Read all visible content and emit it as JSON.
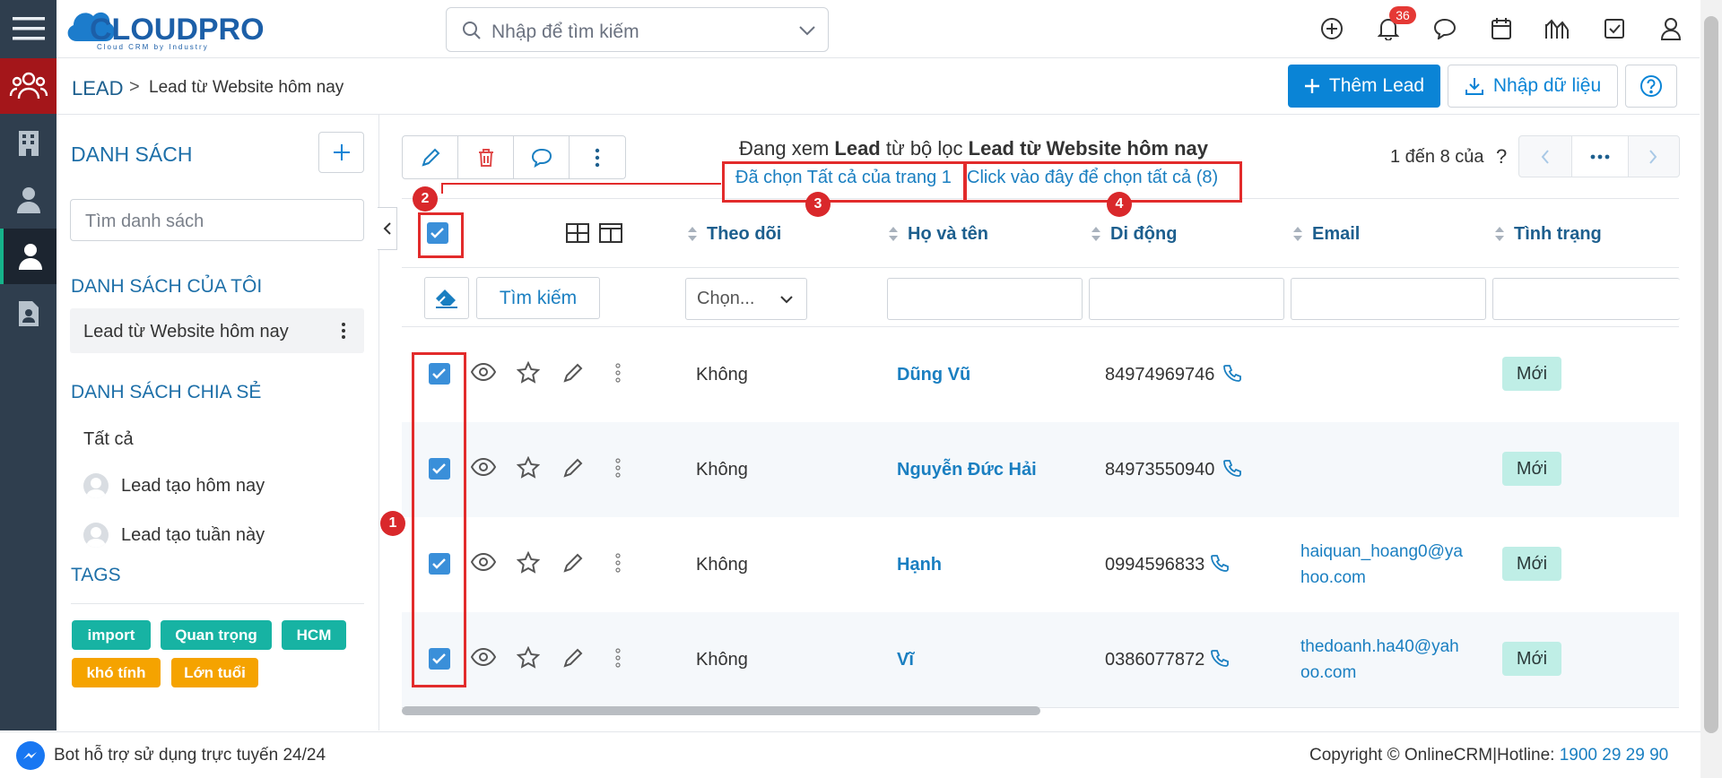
{
  "brand": {
    "logo_text": "CLOUDPRO",
    "tagline": "Cloud CRM by Industry"
  },
  "search": {
    "placeholder": "Nhập để tìm kiếm"
  },
  "header": {
    "notifications_count": "36"
  },
  "breadcrumb": {
    "module": "LEAD",
    "separator": ">",
    "current": "Lead từ Website hôm nay"
  },
  "actions": {
    "add_lead": "Thêm Lead",
    "import": "Nhập dữ liệu"
  },
  "sidebar": {
    "list_title": "DANH SÁCH",
    "search_placeholder": "Tìm danh sách",
    "my_lists_title": "DANH SÁCH CỦA TÔI",
    "my_lists": [
      "Lead từ Website hôm nay"
    ],
    "shared_title": "DANH SÁCH CHIA SẺ",
    "shared": [
      "Tất cả",
      "Lead tạo hôm nay",
      "Lead tạo tuần này"
    ],
    "tags_title": "TAGS",
    "tags": [
      {
        "label": "import",
        "color": "#17b3a3"
      },
      {
        "label": "Quan trọng",
        "color": "#17b3a3"
      },
      {
        "label": "HCM",
        "color": "#17b3a3"
      },
      {
        "label": "khó tính",
        "color": "#f5a300"
      },
      {
        "label": "Lớn tuổi",
        "color": "#f5a300"
      }
    ]
  },
  "viewing": {
    "prefix": "Đang xem ",
    "module": "Lead",
    "middle": " từ bộ lọc ",
    "filter": "Lead từ Website hôm nay",
    "selected_page": "Đã chọn Tất cả của trang 1",
    "select_all": "Click vào đây để chọn tất cả (8)"
  },
  "pagination": {
    "range": "1 đến 8 của",
    "unknown": "?"
  },
  "columns": [
    "Theo dõi",
    "Họ và tên",
    "Di động",
    "Email",
    "Tình trạng"
  ],
  "filters": {
    "search_button": "Tìm kiếm",
    "select_placeholder": "Chọn..."
  },
  "rows": [
    {
      "follow": "Không",
      "name": "Dũng Vũ",
      "phone": "84974969746",
      "email_line1": "",
      "email_line2": "",
      "status": "Mới"
    },
    {
      "follow": "Không",
      "name": "Nguyễn Đức Hải",
      "phone": "84973550940",
      "email_line1": "",
      "email_line2": "",
      "status": "Mới"
    },
    {
      "follow": "Không",
      "name": "Hạnh",
      "phone": "0994596833",
      "email_line1": "haiquan_hoang0@ya",
      "email_line2": "hoo.com",
      "status": "Mới"
    },
    {
      "follow": "Không",
      "name": "Vĩ",
      "phone": "0386077872",
      "email_line1": "thedoanh.ha40@yah",
      "email_line2": "oo.com",
      "status": "Mới"
    }
  ],
  "annotations": [
    "1",
    "2",
    "3",
    "4"
  ],
  "footer": {
    "bot_text": "Bot hỗ trợ sử dụng trực tuyến 24/24",
    "copyright": "Copyright © OnlineCRM",
    "separator": "|",
    "hotline_label": "Hotline: ",
    "hotline": "1900 29 29 90"
  },
  "colors": {
    "primary": "#0a84d6",
    "rail": "#2f3e4e",
    "rail_active": "#a4161a",
    "annotation": "#e22b2b"
  }
}
